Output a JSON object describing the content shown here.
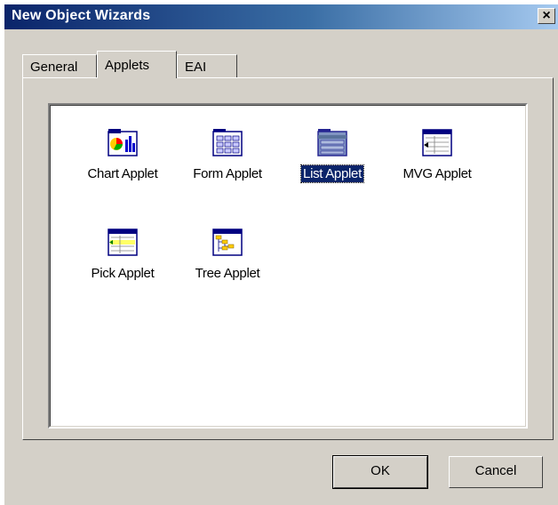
{
  "window": {
    "title": "New Object Wizards",
    "close_glyph": "×"
  },
  "tabs": [
    {
      "label": "General"
    },
    {
      "label": "Applets"
    },
    {
      "label": "EAI"
    }
  ],
  "active_tab": "Applets",
  "items": [
    {
      "label": "Chart Applet",
      "icon": "chart-applet-icon"
    },
    {
      "label": "Form Applet",
      "icon": "form-applet-icon"
    },
    {
      "label": "List Applet",
      "icon": "list-applet-icon",
      "selected": true
    },
    {
      "label": "MVG Applet",
      "icon": "mvg-applet-icon"
    },
    {
      "label": "Pick Applet",
      "icon": "pick-applet-icon"
    },
    {
      "label": "Tree Applet",
      "icon": "tree-applet-icon"
    }
  ],
  "buttons": {
    "ok": "OK",
    "cancel": "Cancel"
  },
  "colors": {
    "titlebar_start": "#0a246a",
    "titlebar_end": "#a6caf0",
    "selection": "#0a246a",
    "face": "#d4d0c8"
  }
}
